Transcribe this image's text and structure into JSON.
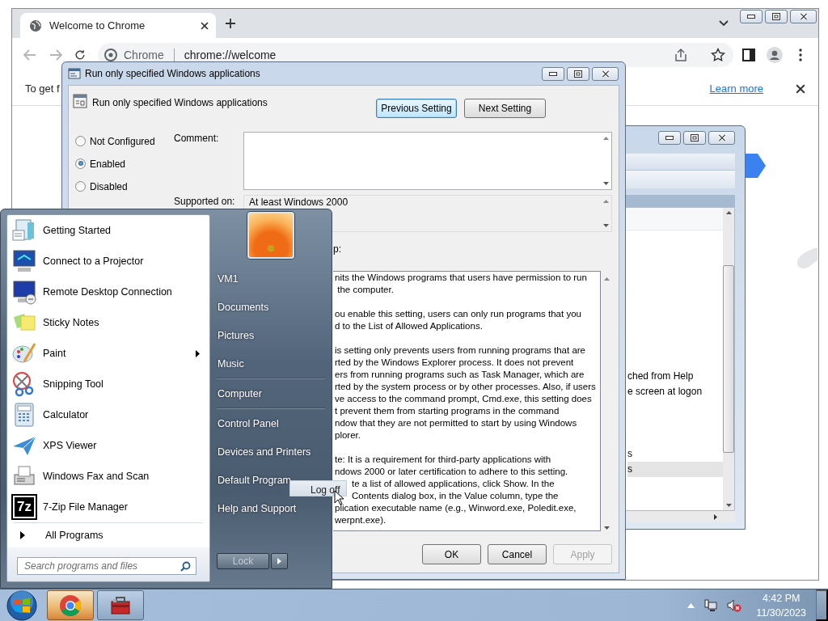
{
  "chrome": {
    "tab_title": "Welcome to Chrome",
    "site_chip": "Chrome",
    "url": "chrome://welcome",
    "infobar_text": "To get f",
    "infobar_link": "Learn more"
  },
  "background_window": {
    "rows": [
      {
        "text": "ched from Help",
        "selected": false
      },
      {
        "text": "e screen at logon",
        "selected": false
      },
      {
        "text": "s",
        "selected": false
      },
      {
        "text": "s",
        "selected": true
      }
    ]
  },
  "dialog": {
    "title": "Run only specified Windows applications",
    "setting_name": "Run only specified Windows applications",
    "nav_buttons": [
      {
        "label": "Previous Setting",
        "focused": true
      },
      {
        "label": "Next Setting",
        "focused": false
      }
    ],
    "states": [
      {
        "label": "Not Configured",
        "selected": false
      },
      {
        "label": "Enabled",
        "selected": true
      },
      {
        "label": "Disabled",
        "selected": false
      }
    ],
    "comment_label": "Comment:",
    "supported_label": "Supported on:",
    "supported_value": "At least Windows 2000",
    "help_label": "p:",
    "help_paragraphs": [
      [
        {
          "text": "nits the Windows programs that users have permission to run",
          "kind": "line"
        },
        {
          "text": " the computer.",
          "kind": "line"
        }
      ],
      [
        {
          "text": "ou enable this setting, users can only run programs that you",
          "kind": "line"
        },
        {
          "text": "d to the List of Allowed Applications.",
          "kind": "line"
        }
      ],
      [
        {
          "text": "is setting only prevents users from running programs that are",
          "kind": "line"
        },
        {
          "text": "rted by the Windows Explorer process. It does not prevent",
          "kind": "line"
        },
        {
          "text": "ers from running programs such as Task Manager, which are",
          "kind": "line"
        },
        {
          "text": "rted by the system process or by other processes. Also, if users",
          "kind": "line"
        },
        {
          "text": "ve access to the command prompt, Cmd.exe, this setting does",
          "kind": "line"
        },
        {
          "text": "t prevent them from starting programs in the command",
          "kind": "line"
        },
        {
          "text": "ndow that they are not permitted to start by using Windows",
          "kind": "line"
        },
        {
          "text": "plorer.",
          "kind": "line"
        }
      ],
      [
        {
          "text": "te: It is a requirement for third-party applications with",
          "kind": "line"
        },
        {
          "text": "ndows 2000 or later certification to adhere to this setting.",
          "kind": "line"
        },
        {
          "text": "te a list of allowed applications, click Show. In the",
          "kind": "behind-flyout"
        },
        {
          "text": "Contents dialog box, in the Value column, type the",
          "kind": "behind-flyout"
        },
        {
          "text": "plication executable name (e.g., Winword.exe, Poledit.exe,",
          "kind": "line"
        },
        {
          "text": "werpnt.exe).",
          "kind": "line"
        }
      ]
    ],
    "buttons": [
      {
        "label": "OK",
        "disabled": false
      },
      {
        "label": "Cancel",
        "disabled": false
      },
      {
        "label": "Apply",
        "disabled": true
      }
    ]
  },
  "start_menu": {
    "programs": [
      {
        "label": "Getting Started",
        "submenu": false
      },
      {
        "label": "Connect to a Projector",
        "submenu": false
      },
      {
        "label": "Remote Desktop Connection",
        "submenu": false
      },
      {
        "label": "Sticky Notes",
        "submenu": false
      },
      {
        "label": "Paint",
        "submenu": true
      },
      {
        "label": "Snipping Tool",
        "submenu": false
      },
      {
        "label": "Calculator",
        "submenu": false
      },
      {
        "label": "XPS Viewer",
        "submenu": false
      },
      {
        "label": "Windows Fax and Scan",
        "submenu": false
      },
      {
        "label": "7-Zip File Manager",
        "submenu": false,
        "icon_text": "7z"
      }
    ],
    "all_programs": "All Programs",
    "search": {
      "placeholder": "Search programs and files"
    },
    "places": [
      {
        "label": "VM1",
        "divider_after": false
      },
      {
        "label": "Documents",
        "divider_after": false
      },
      {
        "label": "Pictures",
        "divider_after": false
      },
      {
        "label": "Music",
        "divider_after": true
      },
      {
        "label": "Computer",
        "divider_after": true
      },
      {
        "label": "Control Panel",
        "divider_after": false
      },
      {
        "label": "Devices and Printers",
        "divider_after": false
      },
      {
        "label": "Default Program",
        "divider_after": false
      },
      {
        "label": "Help and Support",
        "divider_after": false
      }
    ],
    "shutdown_button": "Lock",
    "flyout": {
      "label": "Log off"
    }
  },
  "taskbar": {
    "buttons": [
      {
        "active": true
      },
      {
        "active": false
      }
    ],
    "clock": {
      "time": "4:42 PM",
      "date": "11/30/2023"
    }
  }
}
